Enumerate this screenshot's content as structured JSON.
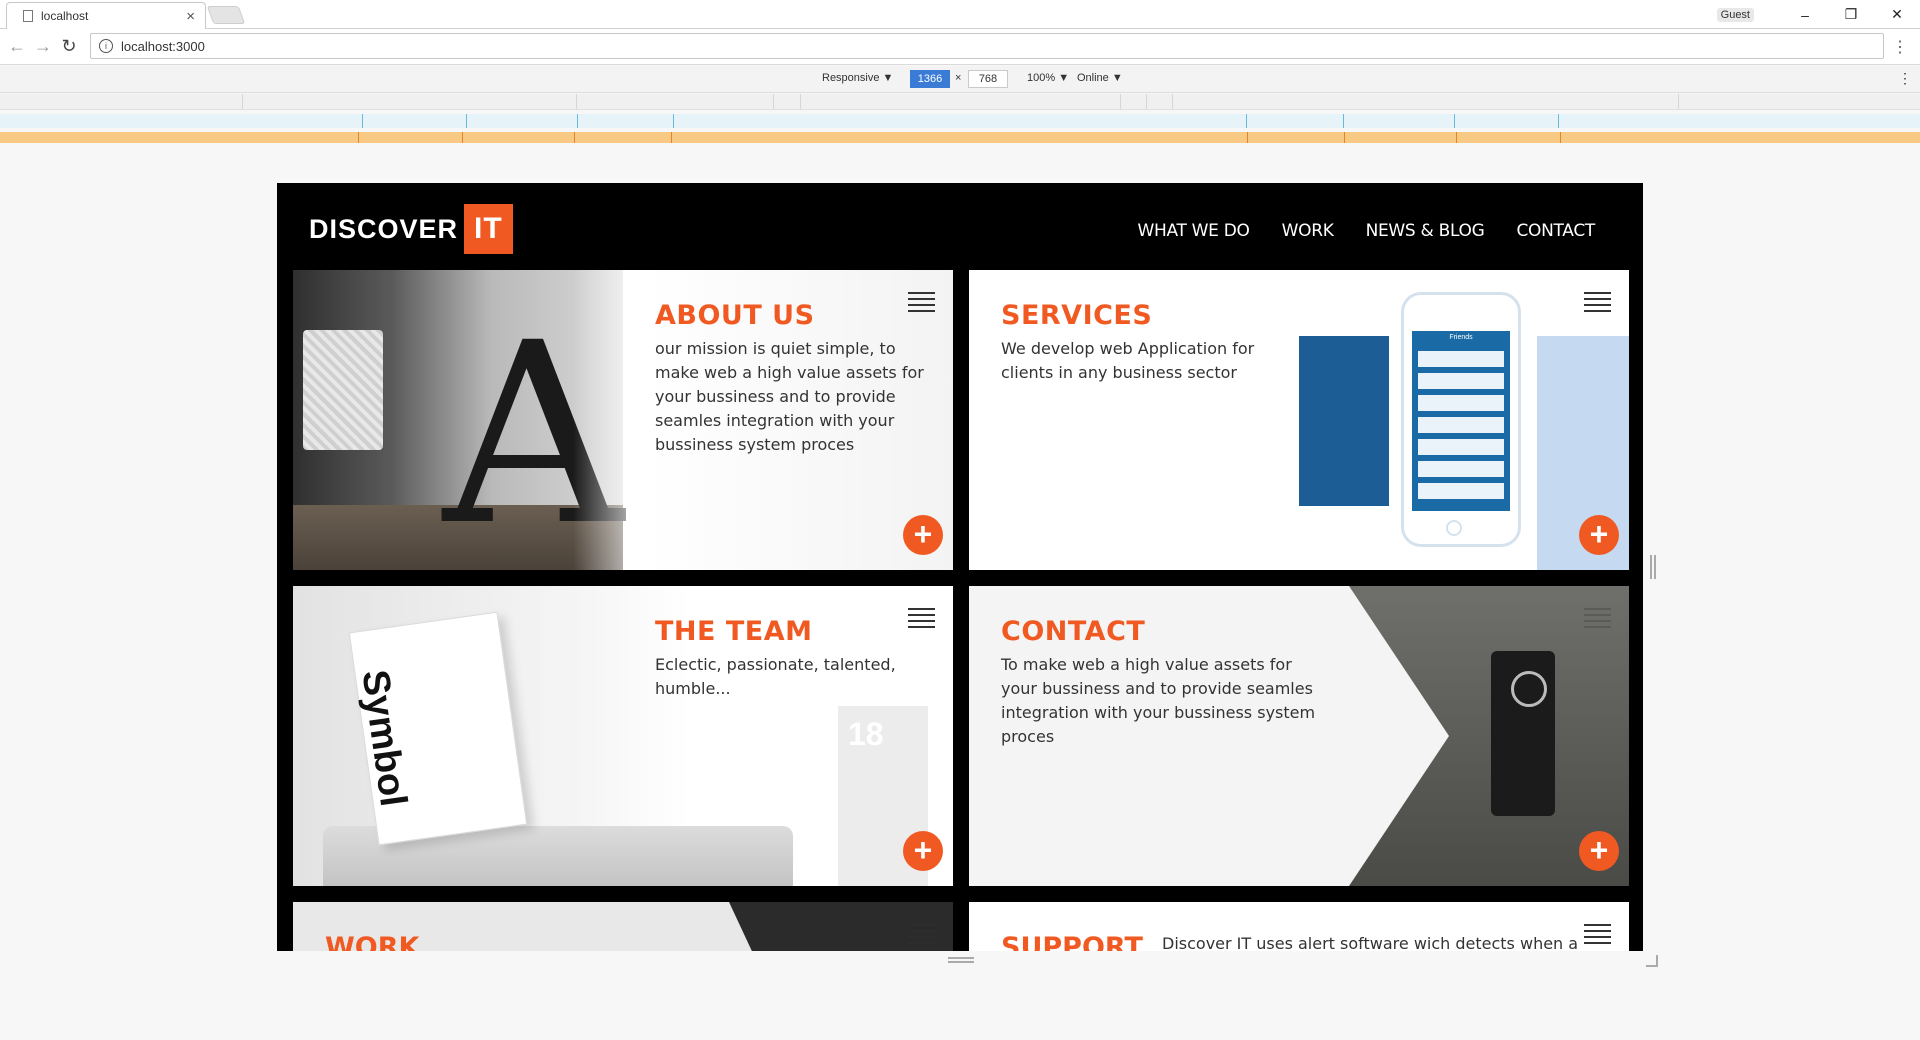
{
  "browser": {
    "tab_title": "localhost",
    "tab_close": "×",
    "profile": "Guest",
    "window_min": "–",
    "window_restore": "❐",
    "window_close": "✕",
    "back": "←",
    "forward": "→",
    "reload": "↻",
    "url": "localhost:3000",
    "info": "i",
    "menu": "⋮"
  },
  "devtools": {
    "device": "Responsive ▼",
    "width": "1366",
    "times": "×",
    "height": "768",
    "zoom": "100% ▼",
    "network": "Online ▼",
    "menu": "⋮"
  },
  "site": {
    "logo_text": "DISCOVER",
    "logo_accent": "IT",
    "nav": [
      "WHAT WE DO",
      "WORK",
      "NEWS & BLOG",
      "CONTACT"
    ],
    "cards": {
      "about": {
        "title": "ABOUT US",
        "text": "our mission is quiet simple, to make web a high value assets for your bussiness and to provide seamles integration with your bussiness system proces"
      },
      "services": {
        "title": "SERVICES",
        "text": "We develop web Application for clients in any business sector",
        "phone_header": "Friends"
      },
      "team": {
        "title": "THE TEAM",
        "text": "Eclectic, passionate, talented, humble...",
        "book_text": "Symbol",
        "deco_number": "18"
      },
      "contact": {
        "title": "CONTACT",
        "text": "To make web a high value assets for your bussiness and to provide seamles integration with your bussiness system proces"
      },
      "work": {
        "title": "WORK"
      },
      "support": {
        "title": "SUPPORT",
        "text": "Discover IT uses alert software wich detects when a"
      }
    },
    "plus_symbol": "+"
  },
  "colors": {
    "accent": "#f05a22",
    "header_bg": "#000000",
    "text": "#333333"
  }
}
